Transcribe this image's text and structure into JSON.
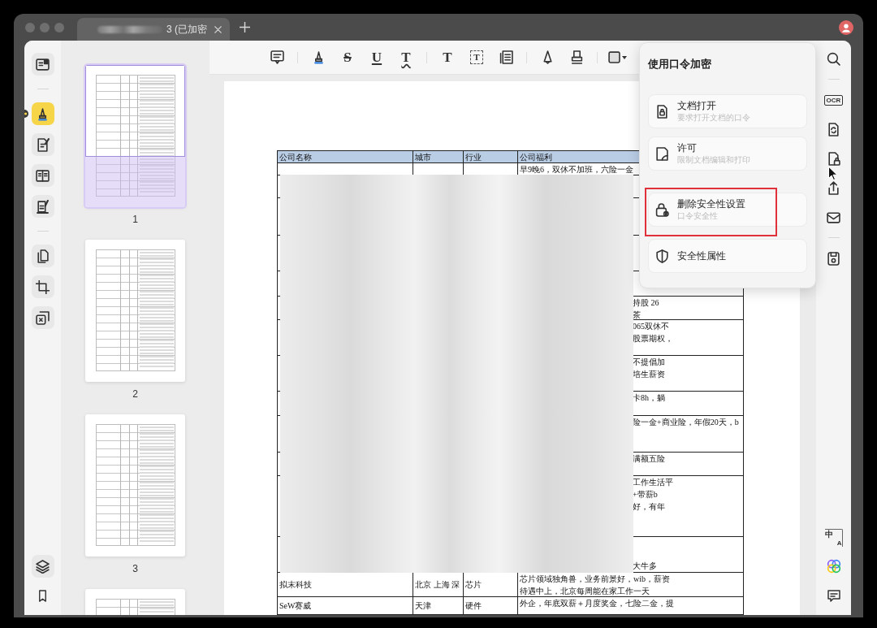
{
  "window": {
    "tab_title": "3 (已加密"
  },
  "toolbar": {
    "glyph_tools": [
      {
        "text": "S",
        "kind": "strikethrough"
      },
      {
        "text": "U",
        "kind": "underline"
      },
      {
        "text": "T",
        "kind": "squiggly"
      },
      {
        "text": "T",
        "kind": "text"
      },
      {
        "text": "T",
        "kind": "text-box"
      }
    ]
  },
  "left_rail": {
    "items": [
      {
        "selected": false
      },
      {
        "selected": true
      },
      {
        "selected": false
      },
      {
        "selected": false
      },
      {
        "selected": false
      },
      {
        "selected": false
      },
      {
        "selected": false
      },
      {
        "selected": false
      }
    ]
  },
  "thumbnails": [
    {
      "label": "1",
      "selected": true
    },
    {
      "label": "2",
      "selected": false
    },
    {
      "label": "3",
      "selected": false
    },
    {
      "selected": false
    }
  ],
  "document": {
    "table": {
      "columns": [
        "公司名称",
        "城市",
        "行业",
        "公司福利"
      ],
      "rows": [
        {
          "redacted": false,
          "benefits": [
            "早9晚6，双休不加班，六险一金"
          ]
        },
        {
          "redacted": true
        },
        {
          "redacted": true
        },
        {
          "redacted": true
        },
        {
          "redacted": true
        },
        {
          "redacted": true,
          "benefits": [
            "持股 26",
            "茶"
          ]
        },
        {
          "redacted": true,
          "benefits": [
            "065双休不",
            "股票期权，"
          ]
        },
        {
          "redacted": true,
          "benefits": [
            "不提倡加",
            "培生薪资"
          ]
        },
        {
          "redacted": true,
          "benefits": [
            "卡8h，躺"
          ]
        },
        {
          "redacted": true,
          "benefits": [
            "险一金+商业险，年假20天，b"
          ]
        },
        {
          "redacted": true,
          "benefits": [
            "满额五险"
          ]
        },
        {
          "redacted": true,
          "benefits": [
            "工作生活平",
            "+带薪b",
            "好，有年"
          ]
        },
        {
          "redacted": true,
          "benefits": [
            "大牛多"
          ]
        },
        {
          "redacted": false,
          "company": "拟末科技",
          "city": "北京 上海 深",
          "industry": "芯片",
          "benefits": [
            "芯片领域独角兽，业务前景好，wib，薪资",
            "待遇中上，北京每周能在家工作一天"
          ]
        },
        {
          "redacted": false,
          "company": "SeW赛威",
          "city": "天津",
          "industry": "硬件",
          "benefits": [
            "外企，年底双薪＋月度奖金，七险二金，提"
          ]
        }
      ]
    }
  },
  "popup": {
    "title": "使用口令加密",
    "items": [
      {
        "title": "文档打开",
        "subtitle": "要求打开文档的口令",
        "highlighted": false
      },
      {
        "title": "许可",
        "subtitle": "限制文档编辑和打印",
        "highlighted": false
      },
      {
        "title": "删除安全性设置",
        "subtitle": "口令安全性",
        "highlighted": true
      },
      {
        "title": "安全性属性",
        "highlighted": false
      }
    ]
  },
  "right_rail": {
    "ocr_label": "OCR",
    "translate_glyphs": [
      "中",
      "A"
    ]
  }
}
